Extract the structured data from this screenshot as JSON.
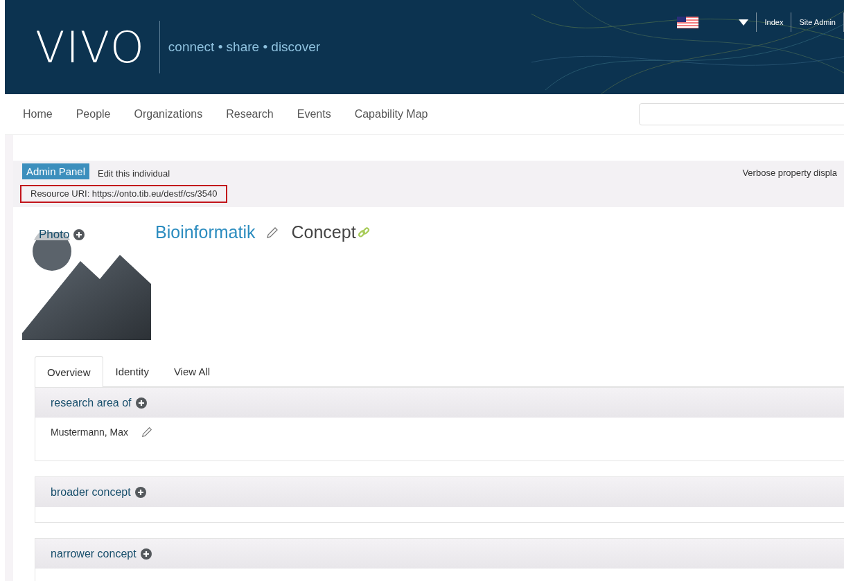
{
  "header": {
    "logo": "VIVO",
    "tagline": "connect • share • discover",
    "links": [
      "Index",
      "Site Admin"
    ]
  },
  "nav": {
    "items": [
      "Home",
      "People",
      "Organizations",
      "Research",
      "Events",
      "Capability Map"
    ]
  },
  "admin": {
    "button": "Admin Panel",
    "edit_link": "Edit this individual",
    "verbose": "Verbose property displa",
    "resource_uri": "Resource URI: https://onto.tib.eu/destf/cs/3540"
  },
  "profile": {
    "photo_label": "Photo",
    "name": "Bioinformatik",
    "type": "Concept"
  },
  "tabs": [
    {
      "label": "Overview",
      "selected": true
    },
    {
      "label": "Identity",
      "selected": false
    },
    {
      "label": "View All",
      "selected": false
    }
  ],
  "sections": [
    {
      "title": "research area of",
      "items": [
        "Mustermann, Max"
      ]
    },
    {
      "title": "broader concept"
    },
    {
      "title": "narrower concept"
    }
  ]
}
